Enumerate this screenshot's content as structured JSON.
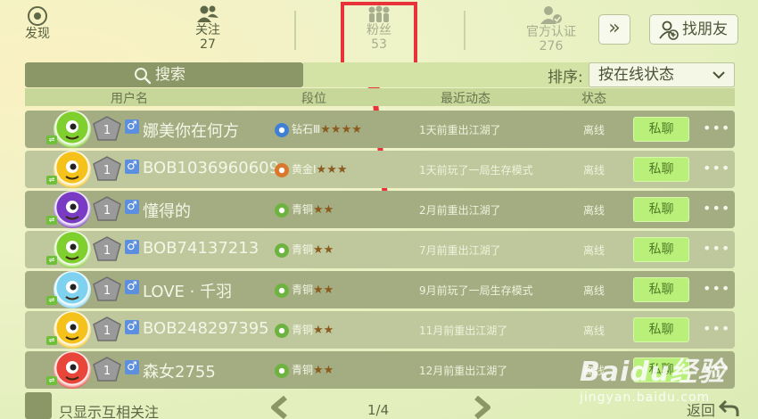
{
  "nav": {
    "discover": {
      "label": "发现"
    },
    "following": {
      "label": "关注",
      "count": "27"
    },
    "fans": {
      "label": "粉丝",
      "count": "53"
    },
    "official": {
      "label": "官方认证",
      "count": "276"
    },
    "more": "»",
    "find_friends": "找朋友"
  },
  "search": {
    "label": "搜索"
  },
  "sort": {
    "label": "排序:",
    "value": "按在线状态"
  },
  "columns": [
    "用户名",
    "段位",
    "最近动态",
    "状态"
  ],
  "rows": [
    {
      "avatar": "green-monster",
      "avatar_color": "#7fcf2f",
      "level": "1",
      "gender": "♂",
      "name": "娜美你在何方",
      "rank": "钻石Ⅲ",
      "rank_color": "#3f7fd6",
      "stars": "★★★★",
      "activity": "1天前重出江湖了",
      "status": "离线",
      "chat": "私聊",
      "more": "•••"
    },
    {
      "avatar": "yellow-monster",
      "avatar_color": "#f5c21c",
      "level": "1",
      "gender": "♂",
      "name": "BOB1036960609",
      "rank": "黄金Ⅰ",
      "rank_color": "#d9772a",
      "stars": "★★★",
      "activity": "1天前玩了一局生存模式",
      "status": "离线",
      "chat": "私聊",
      "more": "•••"
    },
    {
      "avatar": "purple-monster",
      "avatar_color": "#7a3bc4",
      "level": "1",
      "gender": "♂",
      "name": "懂得的",
      "rank": "青铜",
      "rank_color": "#6db33f",
      "stars": "★★",
      "activity": "2月前重出江湖了",
      "status": "离线",
      "chat": "私聊",
      "more": "•••"
    },
    {
      "avatar": "green-monster",
      "avatar_color": "#7fcf2f",
      "level": "1",
      "gender": "♂",
      "name": "BOB74137213",
      "rank": "青铜",
      "rank_color": "#6db33f",
      "stars": "★★",
      "activity": "7月前重出江湖了",
      "status": "离线",
      "chat": "私聊",
      "more": "•••"
    },
    {
      "avatar": "blue-monster",
      "avatar_color": "#7ed2ef",
      "level": "1",
      "gender": "♂",
      "name": "LOVE · 千羽",
      "rank": "青铜",
      "rank_color": "#6db33f",
      "stars": "★★",
      "activity": "9月前玩了一局生存模式",
      "status": "离线",
      "chat": "私聊",
      "more": "•••"
    },
    {
      "avatar": "yellow-monster",
      "avatar_color": "#f5c21c",
      "level": "1",
      "gender": "♂",
      "name": "BOB248297395",
      "rank": "青铜",
      "rank_color": "#6db33f",
      "stars": "★★",
      "activity": "11月前重出江湖了",
      "status": "离线",
      "chat": "私聊",
      "more": "•••"
    },
    {
      "avatar": "red-monster",
      "avatar_color": "#e8453b",
      "level": "1",
      "gender": "♂",
      "name": "森女2755",
      "rank": "青铜",
      "rank_color": "#6db33f",
      "stars": "★★",
      "activity": "12月前重出江湖了",
      "status": "离线",
      "chat": "私聊",
      "more": "•••"
    }
  ],
  "bottom": {
    "mutual_label": "只显示互相关注",
    "page": "1/4",
    "back": "返回"
  },
  "watermark": {
    "main": "Baidu经验",
    "sub": "jingyan.baidu.com"
  },
  "colors": {
    "highlight": "#e8333a",
    "chat_button": "#b9f07a",
    "row_dark": "#a4ad82",
    "row_light": "#bfc89d"
  }
}
